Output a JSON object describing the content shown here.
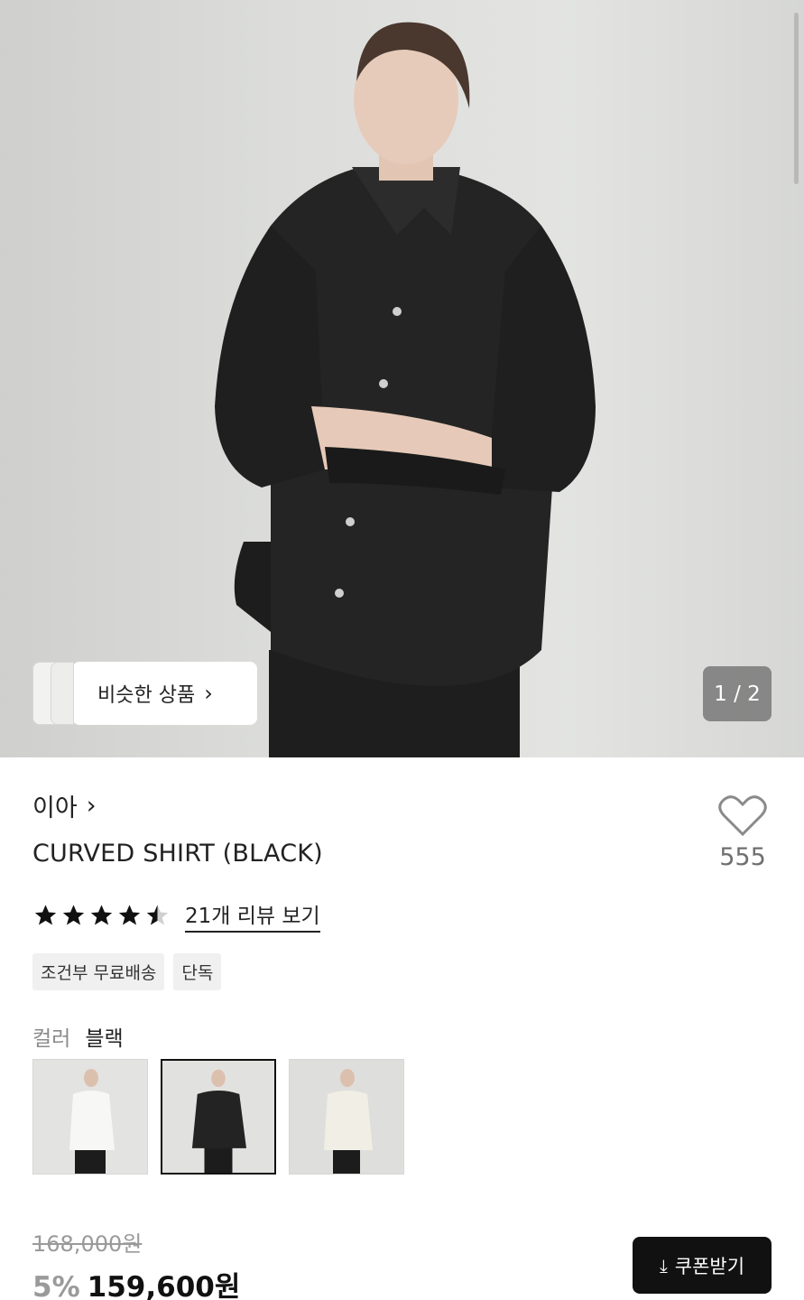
{
  "hero": {
    "counter": "1 / 2",
    "similar_label": "비슷한 상품",
    "chevron_icon": "chevron-right-icon"
  },
  "product": {
    "brand": "이아",
    "title": "CURVED SHIRT (BLACK)",
    "like_count": "555",
    "rating": 4.5,
    "review_link": "21개 리뷰 보기",
    "tags": [
      "조건부 무료배송",
      "단독"
    ],
    "color_label": "컬러",
    "color_value": "블랙",
    "swatches": [
      "white",
      "black",
      "ivory"
    ],
    "selected_swatch": "black",
    "original_price": "168,000원",
    "discount": "5%",
    "price": "159,600원",
    "coupon_label": "쿠폰받기"
  },
  "colors": {
    "accent": "#111111",
    "muted": "#9a9a9a"
  }
}
